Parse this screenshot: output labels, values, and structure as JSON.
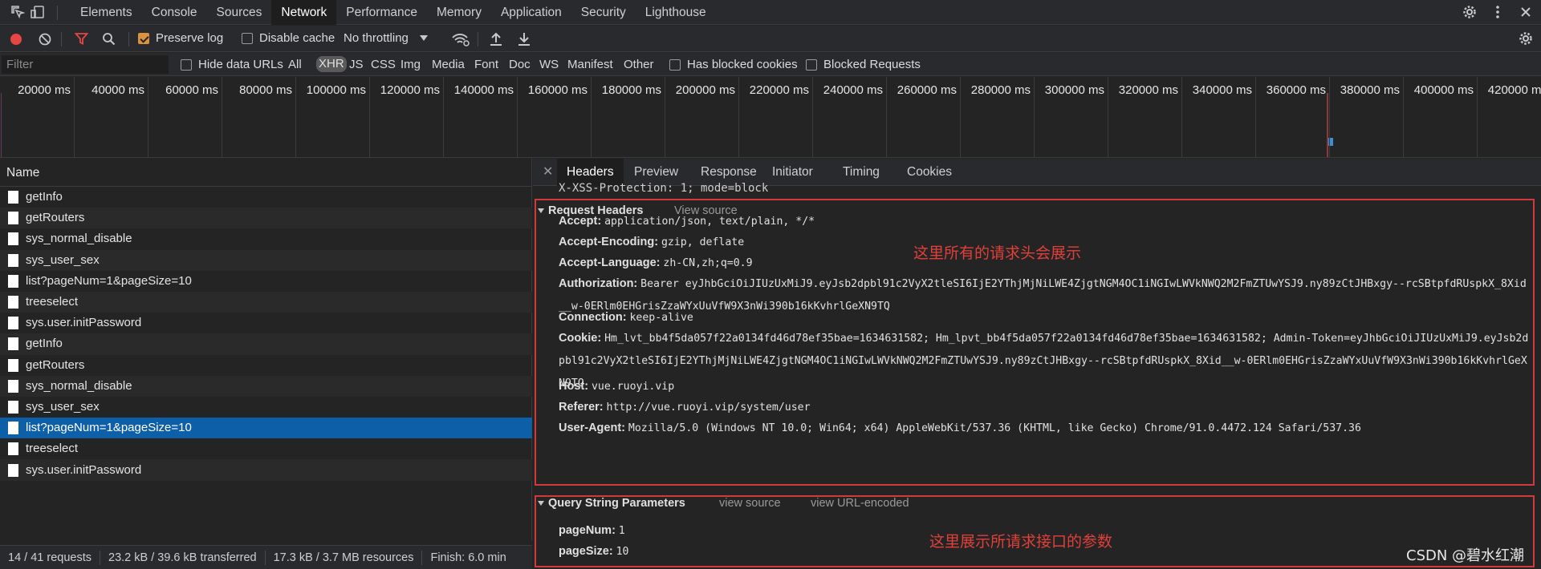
{
  "tabs": [
    "Elements",
    "Console",
    "Sources",
    "Network",
    "Performance",
    "Memory",
    "Application",
    "Security",
    "Lighthouse"
  ],
  "active_tab": "Network",
  "toolbar": {
    "preserve_log": "Preserve log",
    "disable_cache": "Disable cache",
    "throttling": "No throttling"
  },
  "filter": {
    "placeholder": "Filter",
    "hide_data_urls": "Hide data URLs",
    "types": [
      "All",
      "XHR",
      "JS",
      "CSS",
      "Img",
      "Media",
      "Font",
      "Doc",
      "WS",
      "Manifest",
      "Other"
    ],
    "selected_type": "XHR",
    "has_blocked_cookies": "Has blocked cookies",
    "blocked_requests": "Blocked Requests"
  },
  "timeline": {
    "ticks": [
      "20000 ms",
      "40000 ms",
      "60000 ms",
      "80000 ms",
      "100000 ms",
      "120000 ms",
      "140000 ms",
      "160000 ms",
      "180000 ms",
      "200000 ms",
      "220000 ms",
      "240000 ms",
      "260000 ms",
      "280000 ms",
      "300000 ms",
      "320000 ms",
      "340000 ms",
      "360000 ms",
      "380000 ms",
      "400000 ms",
      "420000 ms"
    ]
  },
  "request_list": {
    "header": "Name",
    "rows": [
      "getInfo",
      "getRouters",
      "sys_normal_disable",
      "sys_user_sex",
      "list?pageNum=1&pageSize=10",
      "treeselect",
      "sys.user.initPassword",
      "getInfo",
      "getRouters",
      "sys_normal_disable",
      "sys_user_sex",
      "list?pageNum=1&pageSize=10",
      "treeselect",
      "sys.user.initPassword"
    ],
    "selected_index": 11
  },
  "status": {
    "requests": "14 / 41 requests",
    "transferred": "23.2 kB / 39.6 kB transferred",
    "resources": "17.3 kB / 3.7 MB resources",
    "finish": "Finish: 6.0 min"
  },
  "details": {
    "tabs": [
      "Headers",
      "Preview",
      "Response",
      "Initiator",
      "Timing",
      "Cookies"
    ],
    "active": "Headers",
    "cutoff_line": "X-XSS-Protection: 1; mode=block",
    "request_headers_title": "Request Headers",
    "view_source": "View source",
    "request_headers": [
      {
        "key": "Accept:",
        "value": "application/json, text/plain, */*"
      },
      {
        "key": "Accept-Encoding:",
        "value": "gzip, deflate"
      },
      {
        "key": "Accept-Language:",
        "value": "zh-CN,zh;q=0.9"
      },
      {
        "key": "Authorization:",
        "value": "Bearer eyJhbGciOiJIUzUxMiJ9.eyJsb2dpbl91c2VyX2tleSI6IjE2YThjMjNiLWE4ZjgtNGM4OC1iNGIwLWVkNWQ2M2FmZTUwYSJ9.ny89zCtJHBxgy--rcSBtpfdRUspkX_8Xid__w-0ERlm0EHGrisZzaWYxUuVfW9X3nWi390b16kKvhrlGeXN9TQ"
      },
      {
        "key": "Connection:",
        "value": "keep-alive"
      },
      {
        "key": "Cookie:",
        "value": "Hm_lvt_bb4f5da057f22a0134fd46d78ef35bae=1634631582; Hm_lpvt_bb4f5da057f22a0134fd46d78ef35bae=1634631582; Admin-Token=eyJhbGciOiJIUzUxMiJ9.eyJsb2dpbl91c2VyX2tleSI6IjE2YThjMjNiLWE4ZjgtNGM4OC1iNGIwLWVkNWQ2M2FmZTUwYSJ9.ny89zCtJHBxgy--rcSBtpfdRUspkX_8Xid__w-0ERlm0EHGrisZzaWYxUuVfW9X3nWi390b16kKvhrlGeXN9TQ"
      },
      {
        "key": "Host:",
        "value": "vue.ruoyi.vip"
      },
      {
        "key": "Referer:",
        "value": "http://vue.ruoyi.vip/system/user"
      },
      {
        "key": "User-Agent:",
        "value": "Mozilla/5.0 (Windows NT 10.0; Win64; x64) AppleWebKit/537.36 (KHTML, like Gecko) Chrome/91.0.4472.124 Safari/537.36"
      }
    ],
    "query_title": "Query String Parameters",
    "query_view_source": "view source",
    "query_view_url": "view URL-encoded",
    "query_params": [
      {
        "key": "pageNum:",
        "value": "1"
      },
      {
        "key": "pageSize:",
        "value": "10"
      }
    ]
  },
  "annotations": {
    "headers_note": "这里所有的请求头会展示",
    "params_note": "这里展示所请求接口的参数",
    "accent": "#d03a3a"
  },
  "watermark": "CSDN @碧水红潮",
  "colors": {
    "selected_row": "#0d5fa8",
    "record_button": "#e84545",
    "filter_icon": "#e84545",
    "checkbox_checked": "#d9923f"
  }
}
